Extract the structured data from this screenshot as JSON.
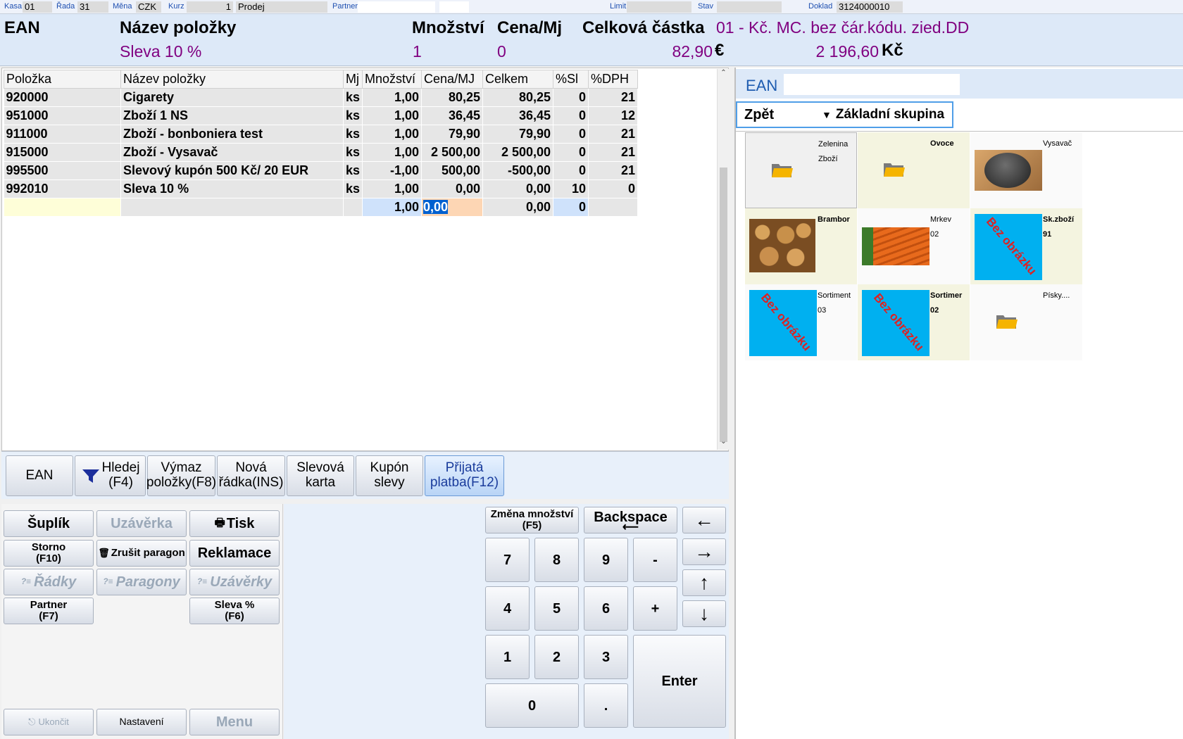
{
  "topbar": {
    "kasa_label": "Kasa",
    "kasa_value": "01",
    "rada_label": "Řada",
    "rada_value": "31",
    "mena_label": "Měna",
    "mena_value": "CZK",
    "kurz_label": "Kurz",
    "kurz_value": "1",
    "mode": "Prodej",
    "partner_label": "Partner",
    "limit_label": "Limit",
    "stav_label": "Stav",
    "doklad_label": "Doklad",
    "doklad_value": "3124000010"
  },
  "header": {
    "ean_label": "EAN",
    "name_label": "Název položky",
    "qty_label": "Množství",
    "price_label": "Cena/Mj",
    "total_label": "Celková částka",
    "info_text": "01 - Kč. MC. bez čár.kódu. zied.DD",
    "current_name": "Sleva 10 %",
    "current_qty": "1",
    "current_price": "0",
    "total_eur": "82,90",
    "eur_symbol": "€",
    "total_czk": "2 196,60",
    "czk_symbol": "Kč"
  },
  "table": {
    "columns": [
      "Položka",
      "Název položky",
      "Mj",
      "Množství",
      "Cena/MJ",
      "Celkem",
      "%Sl",
      "%DPH"
    ],
    "rows": [
      [
        "920000",
        "Cigarety",
        "ks",
        "1,00",
        "80,25",
        "80,25",
        "0",
        "21"
      ],
      [
        "951000",
        "Zboží 1 NS",
        "ks",
        "1,00",
        "36,45",
        "36,45",
        "0",
        "12"
      ],
      [
        "911000",
        "Zboží - bonboniera test",
        "ks",
        "1,00",
        "79,90",
        "79,90",
        "0",
        "21"
      ],
      [
        "915000",
        "Zboží - Vysavač",
        "ks",
        "1,00",
        "2 500,00",
        "2 500,00",
        "0",
        "21"
      ],
      [
        "995500",
        "Slevový kupón 500 Kč/ 20 EUR",
        "ks",
        "-1,00",
        "500,00",
        "-500,00",
        "0",
        "21"
      ],
      [
        "992010",
        "Sleva 10 %",
        "ks",
        "1,00",
        "0,00",
        "0,00",
        "10",
        "0"
      ]
    ],
    "edit_row": {
      "qty": "1,00",
      "price": "0,00",
      "total": "0,00",
      "discount": "0"
    }
  },
  "toolbar": {
    "ean": "EAN",
    "hledej_1": "Hledej",
    "hledej_2": "(F4)",
    "vymaz_1": "Výmaz",
    "vymaz_2": "položky(F8)",
    "nova_1": "Nová",
    "nova_2": "řádka(INS)",
    "slevova_1": "Slevová",
    "slevova_2": "karta",
    "kupon_1": "Kupón",
    "kupon_2": "slevy",
    "prijata_1": "Přijatá",
    "prijata_2": "platba(F12)"
  },
  "actions": {
    "suplik": "Šuplík",
    "uzaverka": "Uzávěrka",
    "tisk": "Tisk",
    "storno_1": "Storno",
    "storno_2": "(F10)",
    "zrusit": "Zrušit paragon",
    "reklamace": "Reklamace",
    "radky": "Řádky",
    "paragony": "Paragony",
    "uzaverky": "Uzávěrky",
    "partner_1": "Partner",
    "partner_2": "(F7)",
    "sleva_1": "Sleva %",
    "sleva_2": "(F6)",
    "ukoncit": "Ukončit",
    "nastaveni": "Nastavení",
    "menu": "Menu"
  },
  "keypad": {
    "zmena_1": "Změna množství",
    "zmena_2": "(F5)",
    "backspace": "Backspace",
    "k7": "7",
    "k8": "8",
    "k9": "9",
    "minus": "-",
    "k4": "4",
    "k5": "5",
    "k6": "6",
    "plus": "+",
    "k1": "1",
    "k2": "2",
    "k3": "3",
    "k0": "0",
    "dot": ".",
    "enter": "Enter"
  },
  "rightpanel": {
    "ean_label": "EAN",
    "back": "Zpět",
    "group": "Základní skupina",
    "tiles": [
      {
        "name": "Zelenina",
        "code": "Zboží"
      },
      {
        "name": "Ovoce",
        "code": ""
      },
      {
        "name": "Vysavač",
        "code": ""
      },
      {
        "name": "Brambor",
        "code": ""
      },
      {
        "name": "Mrkev",
        "code": "02"
      },
      {
        "name": "Sk.zboží",
        "code": "91"
      },
      {
        "name": "Sortiment",
        "code": "03"
      },
      {
        "name": "Sortimer",
        "code": "02"
      },
      {
        "name": "Písky....",
        "code": ""
      }
    ],
    "no_image_text": "Bez obrázku"
  },
  "colors": {
    "header_bg": "#dde9f8",
    "accent_purple": "#800080",
    "tile_yellow": "#f4f4e0",
    "noimage_blue": "#00b0f0"
  }
}
